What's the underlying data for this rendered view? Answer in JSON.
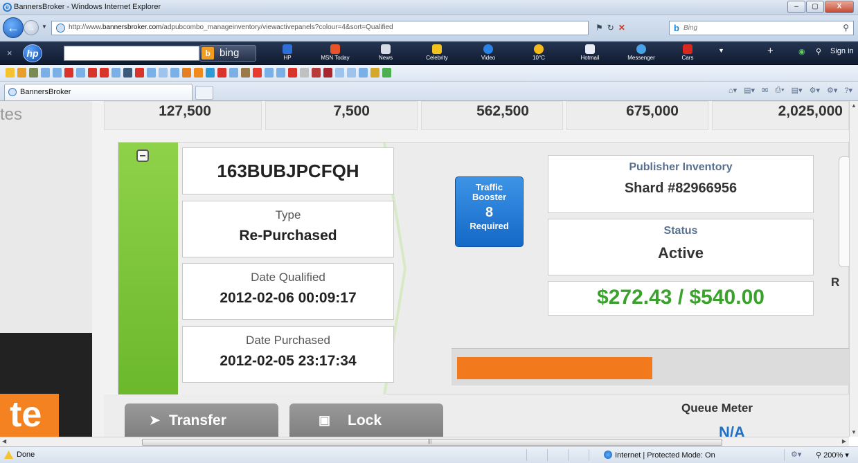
{
  "window": {
    "title": "BannersBroker - Windows Internet Explorer",
    "controls": [
      "–",
      "▢",
      "X"
    ]
  },
  "address": {
    "url_prefix": "http://www.",
    "url_domain": "bannersbroker.com",
    "url_path": "/adpubcombo_manageinventory/viewactivepanels?colour=4&sort=Qualified",
    "search_placeholder": "Bing"
  },
  "hp_toolbar": {
    "bing_label": "bing",
    "items": [
      "HP",
      "MSN Today",
      "News",
      "Celebrity",
      "Video",
      "10°C",
      "Hotmail",
      "Messenger",
      "Cars"
    ],
    "sign_in": "Sign in"
  },
  "tab": {
    "label": "BannersBroker"
  },
  "page": {
    "left_text": "tes",
    "logo_text": "te",
    "stats": [
      "127,500",
      "7,500",
      "562,500",
      "675,000",
      "2,025,000"
    ],
    "panel": {
      "id": "163BUBJPCFQH",
      "type_label": "Type",
      "type_value": "Re-Purchased",
      "qualified_label": "Date Qualified",
      "qualified_value": "2012-02-06 00:09:17",
      "purchased_label": "Date Purchased",
      "purchased_value": "2012-02-05 23:17:34",
      "traffic": {
        "line1": "Traffic",
        "line2": "Booster",
        "count": "8",
        "line3": "Required"
      },
      "publisher_label": "Publisher Inventory",
      "publisher_value": "Shard #82966956",
      "status_label": "Status",
      "status_value": "Active",
      "amount": "$272.43 / $540.00",
      "progress_fraction": 0.5045,
      "side_letter": "R"
    },
    "buttons": {
      "transfer": "Transfer",
      "lock": "Lock"
    },
    "queue_label": "Queue Meter",
    "queue_value": "N/A"
  },
  "statusbar": {
    "done": "Done",
    "zone": "Internet | Protected Mode: On",
    "zoom": "200%"
  },
  "colors": {
    "green": "#6bb82c",
    "money": "#3aa12d",
    "progress": "#f27a1c",
    "traffic": "#1468c7"
  }
}
